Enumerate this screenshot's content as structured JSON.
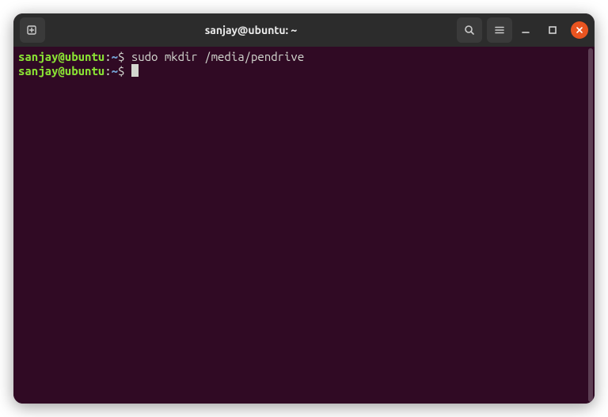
{
  "titlebar": {
    "title": "sanjay@ubuntu: ~"
  },
  "terminal": {
    "lines": [
      {
        "user_host": "sanjay@ubuntu",
        "colon": ":",
        "path": "~",
        "dollar": "$ ",
        "command": "sudo mkdir /media/pendrive"
      },
      {
        "user_host": "sanjay@ubuntu",
        "colon": ":",
        "path": "~",
        "dollar": "$ ",
        "command": ""
      }
    ]
  },
  "colors": {
    "window_bg": "#2c001e",
    "terminal_bg": "#300a24",
    "titlebar_bg": "#2c2c2c",
    "close_btn": "#e95420",
    "prompt_user": "#8ae234",
    "prompt_path": "#729fcf",
    "text": "#d3d7cf"
  }
}
